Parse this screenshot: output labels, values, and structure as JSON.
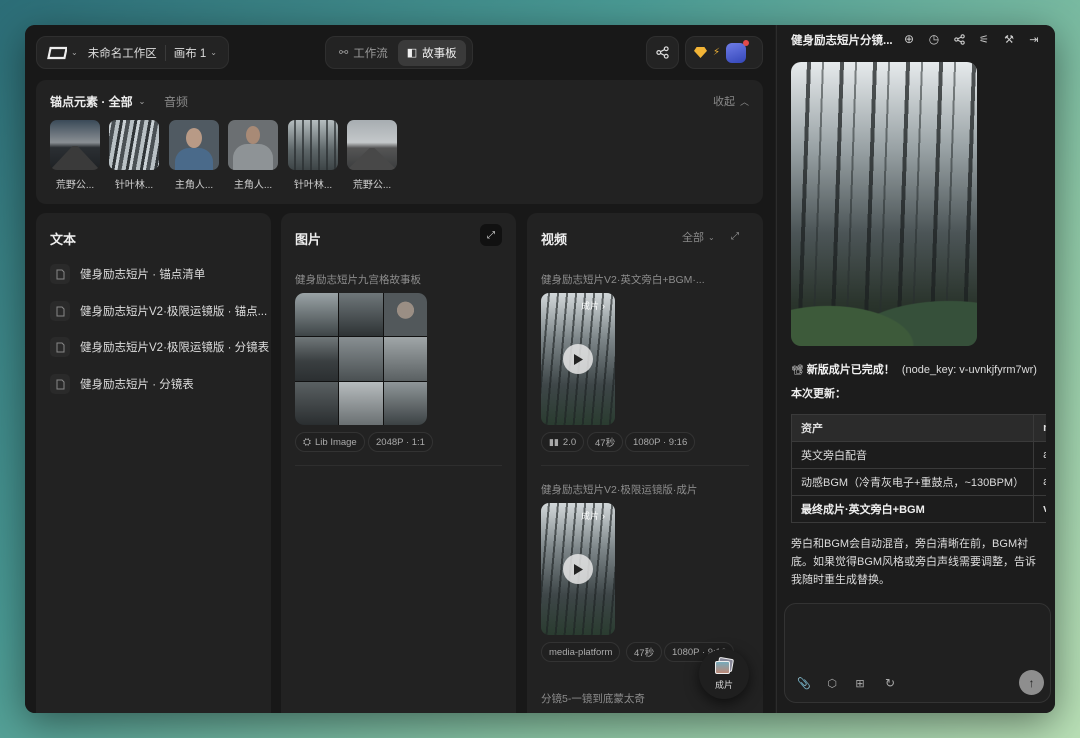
{
  "header": {
    "workspace": "未命名工作区",
    "canvas": "画布 1",
    "tab_flow": "工作流",
    "tab_story": "故事板"
  },
  "anchors": {
    "title": "锚点元素 · 全部",
    "audio_tab": "音频",
    "collapse": "收起",
    "items": [
      {
        "label": "荒野公..."
      },
      {
        "label": "针叶林..."
      },
      {
        "label": "主角人..."
      },
      {
        "label": "主角人..."
      },
      {
        "label": "针叶林..."
      },
      {
        "label": "荒野公..."
      }
    ]
  },
  "text_panel": {
    "title": "文本",
    "docs": [
      "健身励志短片 · 锚点清单",
      "健身励志短片V2·极限运镜版 · 锚点...",
      "健身励志短片V2·极限运镜版 · 分镜表",
      "健身励志短片 · 分镜表"
    ]
  },
  "image_panel": {
    "title": "图片",
    "item_title": "健身励志短片九宫格故事板",
    "chip_model": "Lib Image",
    "chip_size": "2048P · 1:1"
  },
  "video_panel": {
    "title": "视频",
    "filter": "全部",
    "item1": {
      "title": "健身励志短片V2·英文旁白+BGM·...",
      "badge": "成片",
      "chip_version": "2.0",
      "chip_duration": "47秒",
      "chip_res": "1080P · 9:16"
    },
    "item2": {
      "title": "健身励志短片V2·极限运镜版·成片",
      "badge": "成片",
      "chip_source": "media-platform",
      "chip_duration": "47秒",
      "chip_res": "1080P · 9:16"
    },
    "item3": {
      "title": "分镜5-一镜到底蒙太奇"
    },
    "float_label": "成片"
  },
  "chat": {
    "title": "健身励志短片分镜...",
    "msg_emoji": "📽",
    "msg_head": "新版成片已完成！",
    "msg_key": "(node_key: v-uvnkjfyrm7wr)",
    "update_title": "本次更新：",
    "table": {
      "headers": [
        "资产",
        "n"
      ],
      "rows": [
        [
          "英文旁白配音",
          "a·"
        ],
        [
          "动感BGM（冷青灰电子+重鼓点，~130BPM）",
          "a·"
        ],
        [
          "最终成片·英文旁白+BGM",
          "v·"
        ]
      ]
    },
    "paragraph": "旁白和BGM会自动混音，旁白清晰在前，BGM衬底。如果觉得BGM风格或旁白声线需要调整，告诉我随时重生成替换。"
  }
}
